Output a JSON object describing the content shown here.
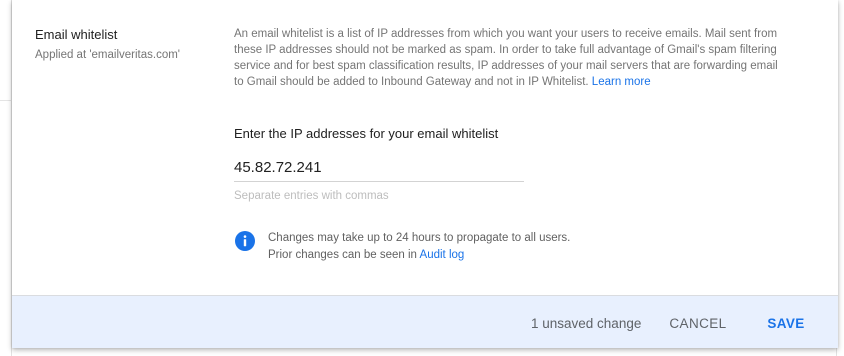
{
  "setting": {
    "title": "Email whitelist",
    "subtitle": "Applied at 'emailveritas.com'",
    "description": "An email whitelist is a list of IP addresses from which you want your users to receive emails. Mail sent from these IP addresses should not be marked as spam. In order to take full advantage of Gmail's spam filtering service and for best spam classification results, IP addresses of your mail servers that are forwarding email to Gmail should be added to Inbound Gateway and not in IP Whitelist.",
    "learn_more": "Learn more"
  },
  "ip_field": {
    "label": "Enter the IP addresses for your email whitelist",
    "value": "45.82.72.241",
    "hint": "Separate entries with commas"
  },
  "info": {
    "icon": "info-icon",
    "line1": "Changes may take up to 24 hours to propagate to all users.",
    "line2_prefix": "Prior changes can be seen in",
    "audit_log": "Audit log"
  },
  "footer": {
    "unsaved": "1 unsaved change",
    "cancel": "CANCEL",
    "save": "SAVE"
  },
  "colors": {
    "accent": "#1a73e8",
    "footer_bg": "#e8f0fe",
    "info_icon": "#1a73e8"
  }
}
